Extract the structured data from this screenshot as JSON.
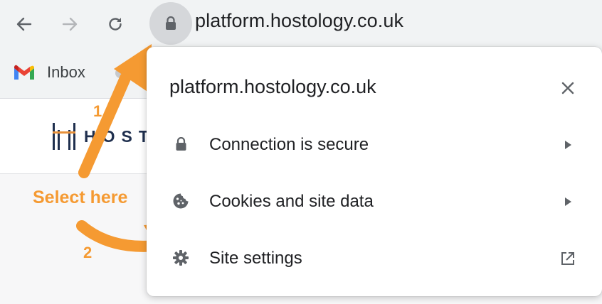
{
  "browser": {
    "url": "platform.hostology.co.uk",
    "bookmarks": [
      {
        "label": "Inbox",
        "icon": "gmail-icon"
      }
    ]
  },
  "site": {
    "logo_text": "HOST"
  },
  "popup": {
    "title": "platform.hostology.co.uk",
    "items": [
      {
        "label": "Connection is secure",
        "icon": "lock-icon",
        "trail": "chevron-right-icon"
      },
      {
        "label": "Cookies and site data",
        "icon": "cookie-icon",
        "trail": "chevron-right-icon"
      },
      {
        "label": "Site settings",
        "icon": "gear-icon",
        "trail": "open-in-new-icon"
      }
    ]
  },
  "annotations": {
    "step1": "1",
    "step2": "2",
    "instruction": "Select here",
    "color": "#f59a32"
  }
}
